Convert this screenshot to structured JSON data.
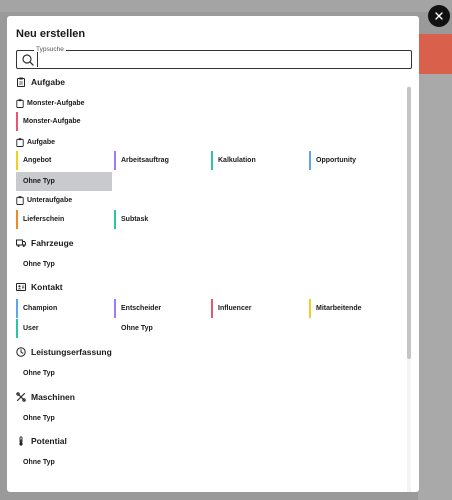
{
  "modal": {
    "title": "Neu erstellen"
  },
  "search": {
    "legend": "Typsuche",
    "value": ""
  },
  "colors": {
    "red": "#e8566f",
    "yellow": "#f2cf1f",
    "violet": "#9b7bff",
    "teal": "#2cc4a8",
    "blue": "#5aa6f0",
    "orange": "#f08a28",
    "selected_bg": "#c8cace",
    "close_bg": "#111111"
  },
  "sections": {
    "aufgabe": {
      "title": "Aufgabe",
      "icon": "clipboard-icon",
      "monster": {
        "title": "Monster-Aufgabe",
        "items": [
          "Monster-Aufgabe"
        ]
      },
      "aufgabe": {
        "title": "Aufgabe",
        "items": [
          "Angebot",
          "Arbeitsauftrag",
          "Kalkulation",
          "Opportunity",
          "Ohne Typ"
        ]
      },
      "unteraufgabe": {
        "title": "Unteraufgabe",
        "items": [
          "Lieferschein",
          "Subtask"
        ]
      }
    },
    "fahrzeuge": {
      "title": "Fahrzeuge",
      "icon": "truck-icon",
      "items": [
        "Ohne Typ"
      ]
    },
    "kontakt": {
      "title": "Kontakt",
      "icon": "contact-card-icon",
      "items": [
        "Champion",
        "Entscheider",
        "Influencer",
        "Mitarbeitende",
        "User",
        "Ohne Typ"
      ]
    },
    "leistungserfassung": {
      "title": "Leistungserfassung",
      "icon": "clock-icon",
      "items": [
        "Ohne Typ"
      ]
    },
    "maschinen": {
      "title": "Maschinen",
      "icon": "tools-icon",
      "items": [
        "Ohne Typ"
      ]
    },
    "potential": {
      "title": "Potential",
      "icon": "thermometer-icon",
      "items": [
        "Ohne Typ"
      ]
    }
  }
}
